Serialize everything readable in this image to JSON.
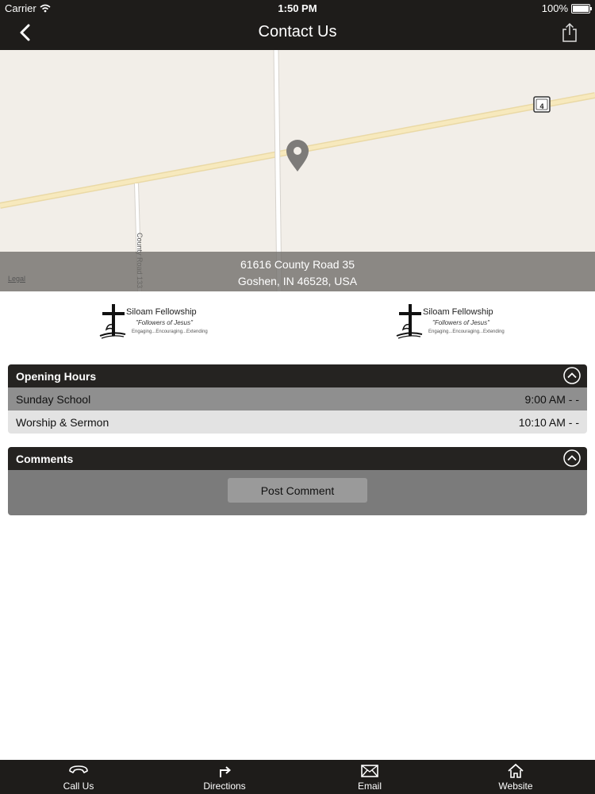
{
  "status": {
    "carrier": "Carrier",
    "time": "1:50 PM",
    "battery": "100%"
  },
  "nav": {
    "title": "Contact Us",
    "back_icon": "chevron-left-icon",
    "share_icon": "share-icon"
  },
  "map": {
    "address_line1": "61616 County Road 35",
    "address_line2": "Goshen, IN 46528, USA",
    "road_label": "County Road 133",
    "route_shield": "4",
    "legal": "Legal"
  },
  "logo": {
    "org_name": "Siloam Fellowship",
    "tagline": "\"Followers of Jesus\"",
    "subline": "Engaging...Encouraging...Extending"
  },
  "opening_hours": {
    "title": "Opening Hours",
    "rows": [
      {
        "name": "Sunday School",
        "hours": "9:00 AM - -"
      },
      {
        "name": "Worship & Sermon",
        "hours": "10:10 AM - -"
      }
    ]
  },
  "comments": {
    "title": "Comments",
    "post_label": "Post Comment"
  },
  "tabs": [
    {
      "label": "Call Us",
      "icon": "phone-icon"
    },
    {
      "label": "Directions",
      "icon": "directions-icon"
    },
    {
      "label": "Email",
      "icon": "email-icon"
    },
    {
      "label": "Website",
      "icon": "home-icon"
    }
  ],
  "colors": {
    "bar": "#1e1c1a",
    "panel_head": "#252321",
    "map_bg": "#f2eee8",
    "road": "#f7e7b4"
  }
}
